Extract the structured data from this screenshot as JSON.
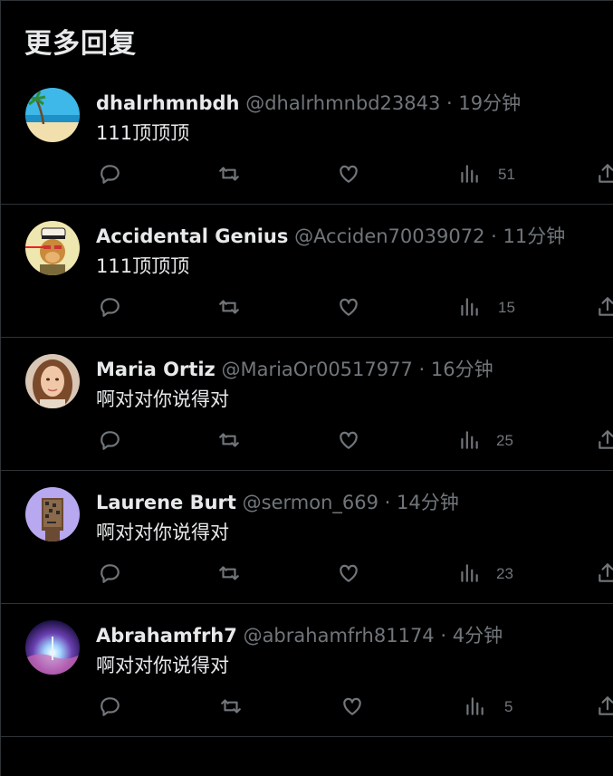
{
  "section": {
    "title": "更多回复"
  },
  "replies": [
    {
      "name": "dhalrhmnbdh",
      "handle": "@dhalrhmnbd23843",
      "sep": "·",
      "time": "19分钟",
      "text": "111顶顶顶",
      "views": "51",
      "avatar": "beach-avatar"
    },
    {
      "name": "Accidental Genius",
      "handle": "@Acciden70039072",
      "sep": "·",
      "time": "11分钟",
      "text": "111顶顶顶",
      "views": "15",
      "avatar": "ape-avatar"
    },
    {
      "name": "Maria Ortiz",
      "handle": "@MariaOr00517977",
      "sep": "·",
      "time": "16分钟",
      "text": "啊对对你说得对",
      "views": "25",
      "avatar": "woman-avatar"
    },
    {
      "name": "Laurene Burt",
      "handle": "@sermon_669",
      "sep": "·",
      "time": "14分钟",
      "text": "啊对对你说得对",
      "views": "23",
      "avatar": "pixel-punk-avatar"
    },
    {
      "name": "Abrahamfrh7",
      "handle": "@abrahamfrh81174",
      "sep": "·",
      "time": "4分钟",
      "text": "啊对对你说得对",
      "views": "5",
      "avatar": "galaxy-avatar"
    }
  ],
  "colors": {
    "background": "#000000",
    "text": "#e7e9ea",
    "muted": "#71767b",
    "divider": "#2f3336"
  }
}
